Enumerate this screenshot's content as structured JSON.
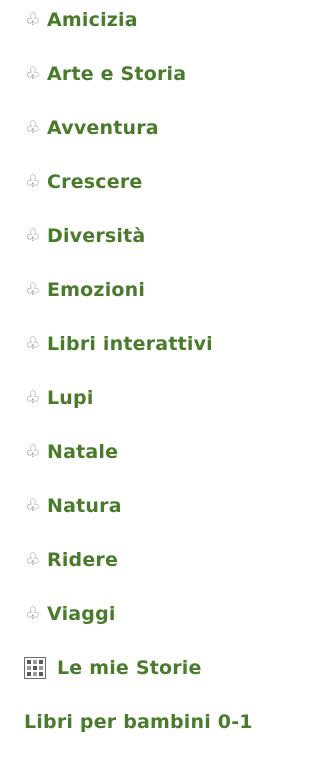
{
  "menu": {
    "items": [
      {
        "label": "Amicizia",
        "icon": "clover-icon"
      },
      {
        "label": "Arte e Storia",
        "icon": "clover-icon"
      },
      {
        "label": "Avventura",
        "icon": "clover-icon"
      },
      {
        "label": "Crescere",
        "icon": "clover-icon"
      },
      {
        "label": "Diversità",
        "icon": "clover-icon"
      },
      {
        "label": "Emozioni",
        "icon": "clover-icon"
      },
      {
        "label": "Libri interattivi",
        "icon": "clover-icon"
      },
      {
        "label": "Lupi",
        "icon": "clover-icon"
      },
      {
        "label": "Natale",
        "icon": "clover-icon"
      },
      {
        "label": "Natura",
        "icon": "clover-icon"
      },
      {
        "label": "Ridere",
        "icon": "clover-icon"
      },
      {
        "label": "Viaggi",
        "icon": "clover-icon"
      }
    ],
    "stories": {
      "label": "Le mie Storie",
      "icon": "grid-icon"
    },
    "books": {
      "label": "Libri per bambini 0-1"
    },
    "clover_glyph": "♧"
  },
  "colors": {
    "link": "#4a7a2c",
    "icon": "#8a8f85",
    "background": "#ffffff"
  }
}
